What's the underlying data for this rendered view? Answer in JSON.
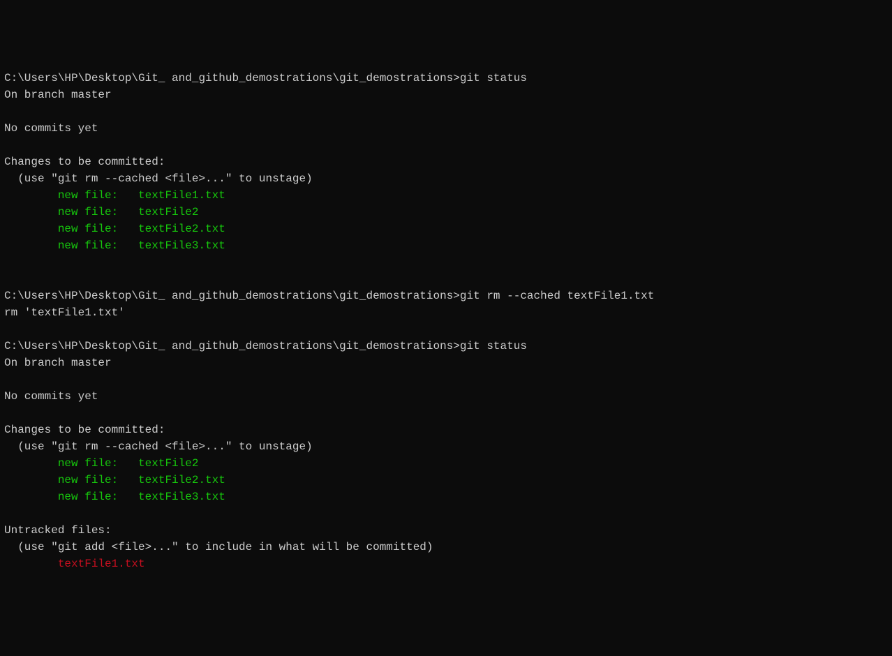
{
  "prompt_path": "C:\\Users\\HP\\Desktop\\Git_ and_github_demostrations\\git_demostrations>",
  "commands": {
    "git_status": "git status",
    "git_rm": "git rm --cached textFile1.txt"
  },
  "output": {
    "branch_line": "On branch master",
    "no_commits": "No commits yet",
    "changes_header": "Changes to be committed:",
    "unstage_hint": "  (use \"git rm --cached <file>...\" to unstage)",
    "rm_output": "rm 'textFile1.txt'",
    "untracked_header": "Untracked files:",
    "untracked_hint": "  (use \"git add <file>...\" to include in what will be committed)"
  },
  "staged_files_1": [
    "        new file:   textFile1.txt",
    "        new file:   textFile2",
    "        new file:   textFile2.txt",
    "        new file:   textFile3.txt"
  ],
  "staged_files_2": [
    "        new file:   textFile2",
    "        new file:   textFile2.txt",
    "        new file:   textFile3.txt"
  ],
  "untracked_files": [
    "        textFile1.txt"
  ]
}
